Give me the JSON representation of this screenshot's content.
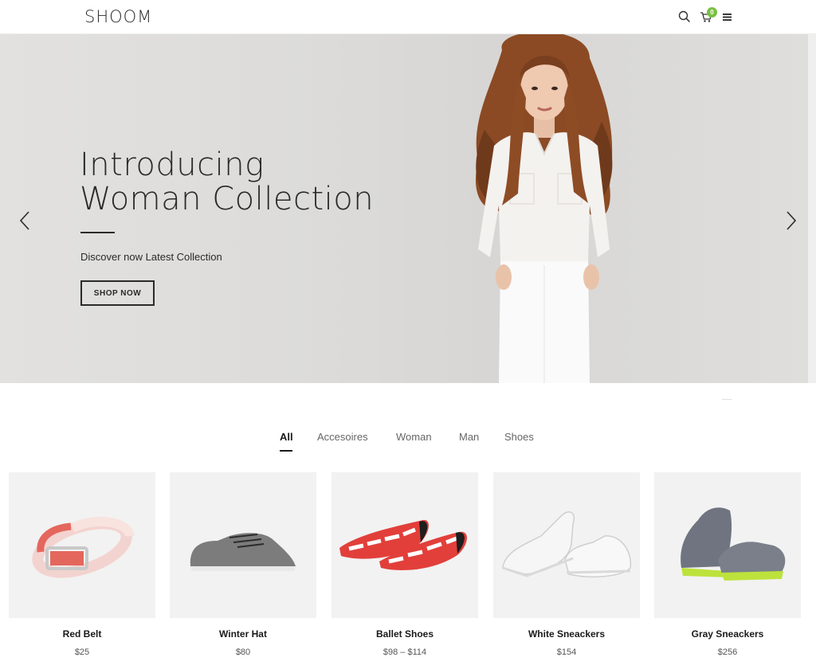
{
  "brand": {
    "logo": "SHOOM"
  },
  "header": {
    "cart_count": "0",
    "icons": [
      "search-icon",
      "cart-icon",
      "menu-icon"
    ]
  },
  "hero": {
    "title_line1": "Introducing",
    "title_line2": "Woman Collection",
    "subtitle": "Discover now Latest Collection",
    "button_label": "SHOP NOW"
  },
  "filters": {
    "tabs": [
      {
        "label": "All",
        "active": true
      },
      {
        "label": "Accesoires",
        "active": false
      },
      {
        "label": "Woman",
        "active": false
      },
      {
        "label": "Man",
        "active": false
      },
      {
        "label": "Shoes",
        "active": false
      }
    ]
  },
  "products": [
    {
      "name": "Red Belt",
      "price": "$25"
    },
    {
      "name": "Winter Hat",
      "price": "$80"
    },
    {
      "name": "Ballet Shoes",
      "price": "$98 – $114"
    },
    {
      "name": "White Sneackers",
      "price": "$154"
    },
    {
      "name": "Gray Sneackers",
      "price": "$256"
    }
  ],
  "colors": {
    "accent_badge": "#7ac043",
    "text_dark": "#2a2a2a",
    "hero_bg": "#dcdbd9",
    "thumb_bg": "#f2f2f2"
  }
}
